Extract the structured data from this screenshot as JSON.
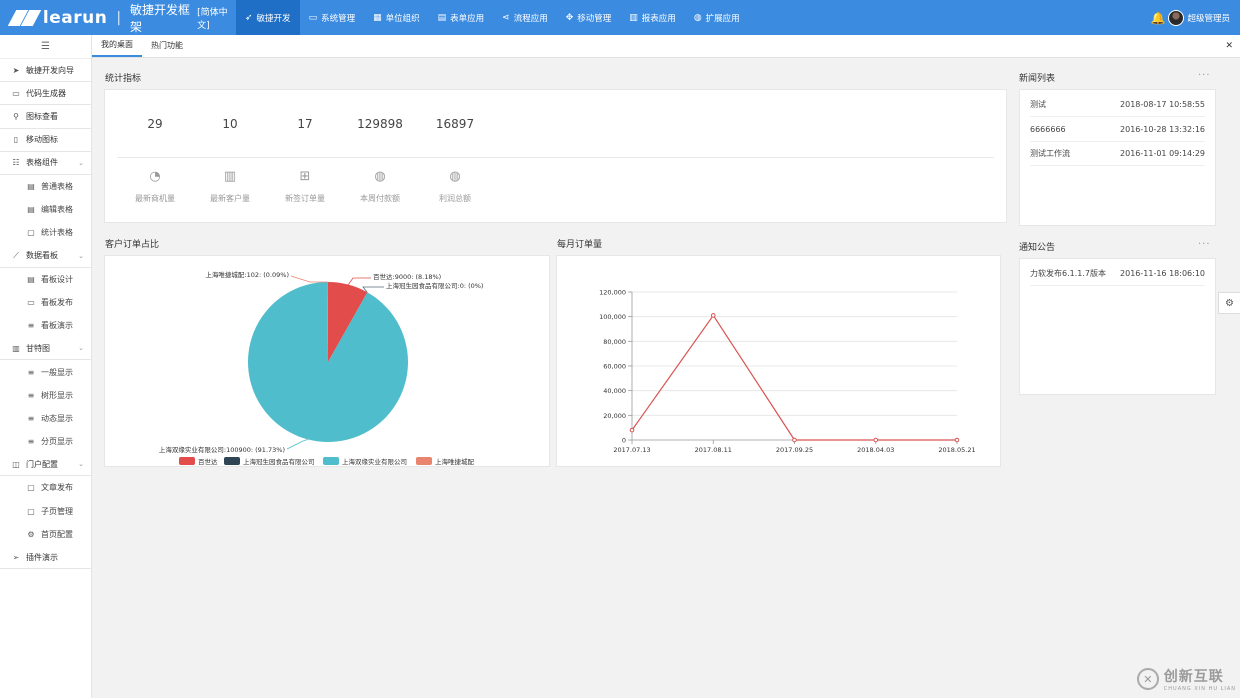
{
  "header": {
    "logo_text": "learun",
    "separator": "|",
    "framework_title": "敏捷开发框架",
    "language": "[简体中文]",
    "nav": [
      {
        "icon": "send-icon",
        "label": "敏捷开发",
        "active": true
      },
      {
        "icon": "monitor-icon",
        "label": "系统管理",
        "active": false
      },
      {
        "icon": "building-icon",
        "label": "单位组织",
        "active": false
      },
      {
        "icon": "table-icon",
        "label": "表单应用",
        "active": false
      },
      {
        "icon": "share-icon",
        "label": "流程应用",
        "active": false
      },
      {
        "icon": "move-icon",
        "label": "移动管理",
        "active": false
      },
      {
        "icon": "chart-icon",
        "label": "报表应用",
        "active": false
      },
      {
        "icon": "globe-icon",
        "label": "扩展应用",
        "active": false
      }
    ],
    "user_name": "超级管理员",
    "accent_color": "#3b8be0"
  },
  "sidebar": {
    "items": [
      {
        "label": "敏捷开发向导",
        "icon": "navigation-arrow-icon",
        "level": 0
      },
      {
        "label": "代码生成器",
        "icon": "monitor-icon",
        "level": 0
      },
      {
        "label": "图标查看",
        "icon": "search-icon",
        "level": 0
      },
      {
        "label": "移动图标",
        "icon": "mobile-icon",
        "level": 0
      },
      {
        "label": "表格组件",
        "icon": "list-icon",
        "level": 0,
        "expandable": true
      },
      {
        "label": "普通表格",
        "icon": "table-icon",
        "level": 1
      },
      {
        "label": "编辑表格",
        "icon": "table-icon",
        "level": 1
      },
      {
        "label": "统计表格",
        "icon": "file-icon",
        "level": 1
      },
      {
        "label": "数据看板",
        "icon": "line-chart-icon",
        "level": 0,
        "expandable": true
      },
      {
        "label": "看板设计",
        "icon": "table-icon",
        "level": 1
      },
      {
        "label": "看板发布",
        "icon": "laptop-icon",
        "level": 1
      },
      {
        "label": "看板演示",
        "icon": "bars-icon",
        "level": 1
      },
      {
        "label": "甘特图",
        "icon": "bar-chart-icon",
        "level": 0,
        "expandable": true
      },
      {
        "label": "一般显示",
        "icon": "bars-icon",
        "level": 1
      },
      {
        "label": "树形显示",
        "icon": "bars-icon",
        "level": 1
      },
      {
        "label": "动态显示",
        "icon": "bars-icon",
        "level": 1
      },
      {
        "label": "分页显示",
        "icon": "bars-icon",
        "level": 1
      },
      {
        "label": "门户配置",
        "icon": "window-icon",
        "level": 0,
        "expandable": true
      },
      {
        "label": "文章发布",
        "icon": "file-icon",
        "level": 1
      },
      {
        "label": "子页管理",
        "icon": "file-icon",
        "level": 1
      },
      {
        "label": "首页配置",
        "icon": "cogs-icon",
        "level": 1
      },
      {
        "label": "插件演示",
        "icon": "paper-plane-icon",
        "level": 0
      }
    ]
  },
  "tabs": [
    {
      "label": "我的桌面",
      "active": true
    },
    {
      "label": "热门功能",
      "active": false
    }
  ],
  "stats": {
    "title": "统计指标",
    "items": [
      {
        "value": "29",
        "label": "最新商机量",
        "icon": "pie-chart-icon"
      },
      {
        "value": "10",
        "label": "最新客户量",
        "icon": "bar-chart-icon"
      },
      {
        "value": "17",
        "label": "新签订单量",
        "icon": "windows-icon"
      },
      {
        "value": "129898",
        "label": "本周付款额",
        "icon": "globe-icon"
      },
      {
        "value": "16897",
        "label": "利润总额",
        "icon": "globe-icon"
      }
    ]
  },
  "news": {
    "title": "新闻列表",
    "more": "···",
    "rows": [
      {
        "title": "测试",
        "time": "2018-08-17 10:58:55"
      },
      {
        "title": "6666666",
        "time": "2016-10-28 13:32:16"
      },
      {
        "title": "测试工作流",
        "time": "2016-11-01 09:14:29"
      }
    ]
  },
  "notice": {
    "title": "通知公告",
    "more": "···",
    "rows": [
      {
        "title": "力软发布6.1.1.7版本",
        "time": "2016-11-16 18:06:10"
      }
    ]
  },
  "chart_data": [
    {
      "type": "pie",
      "title": "客户订单占比",
      "slices": [
        {
          "name": "百世达",
          "value": 9000,
          "label": "百世达:9000: (8.18%)",
          "color": "#e24c4b"
        },
        {
          "name": "上海冠生园食品有限公司",
          "value": 0,
          "label": "上海冠生园食品有限公司:0: (0%)",
          "color": "#2f4554"
        },
        {
          "name": "上海双缘实业有限公司",
          "value": 100900,
          "label": "上海双缘实业有限公司:100900: (91.73%)",
          "color": "#4fbdcb"
        },
        {
          "name": "上海唯捷城配",
          "value": 102,
          "label": "上海唯捷城配:102: (0.09%)",
          "color": "#e9846f"
        }
      ],
      "legend": [
        "百世达",
        "上海冠生园食品有限公司",
        "上海双缘实业有限公司",
        "上海唯捷城配"
      ],
      "legend_position": "bottom"
    },
    {
      "type": "line",
      "title": "每月订单量",
      "x": [
        "2017.07.13",
        "2017.08.11",
        "2017.09.25",
        "2018.04.03",
        "2018.05.21"
      ],
      "y": [
        8000,
        101000,
        0,
        0,
        0
      ],
      "ylim": [
        0,
        120000
      ],
      "yticks": [
        "0",
        "20,000",
        "40,000",
        "60,000",
        "80,000",
        "100,000",
        "120,000"
      ],
      "grid": true,
      "color": "#d9534f"
    }
  ],
  "settings_icon": "gear-icon",
  "watermark": {
    "text": "创新互联",
    "sub": "CHUANG XIN HU LIAN",
    "mark": "✕"
  }
}
